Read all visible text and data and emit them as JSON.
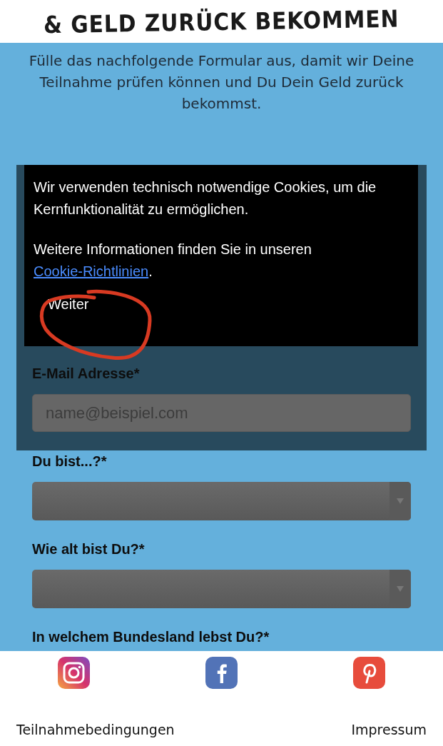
{
  "header": {
    "title": "& GELD ZURÜCK BEKOMMEN"
  },
  "intro": "Fülle das nachfolgende Formular aus, damit wir Deine Teilnahme prüfen können und Du Dein Geld zurück bekommst.",
  "cookie_banner": {
    "text": "Wir verwenden technisch notwendige Cookies, um die Kernfunktionalität zu ermöglichen.",
    "info_text": "Weitere Informationen finden Sie in unseren",
    "link": "Cookie-Richtlinien",
    "after_link": ".",
    "button": "Weiter"
  },
  "form": {
    "fields": [
      {
        "label": "E-Mail Adresse*",
        "kind": "text",
        "placeholder": "name@beispiel.com"
      },
      {
        "label": "Du bist...?*",
        "kind": "select"
      },
      {
        "label": "Wie alt bist Du?*",
        "kind": "select"
      },
      {
        "label": "In welchem Bundesland lebst Du?*",
        "kind": "heading"
      }
    ]
  },
  "footer": {
    "social": [
      {
        "kind": "instagram"
      },
      {
        "kind": "facebook"
      },
      {
        "kind": "pinterest"
      }
    ],
    "links": [
      "Teilnahmebedingungen",
      "Impressum"
    ]
  }
}
